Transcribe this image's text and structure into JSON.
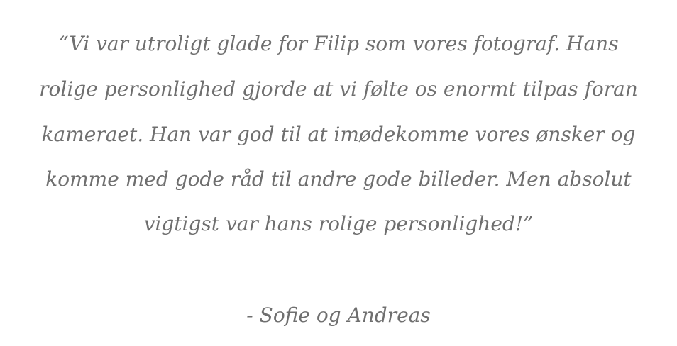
{
  "testimonial": {
    "quote_lines": [
      "“Vi var utroligt glade for Filip som vores fotograf. Hans",
      "rolige personlighed gjorde at vi følte os enormt tilpas foran",
      "kameraet. Han var god til at imødekomme vores ønsker og",
      "komme med gode råd til andre gode billeder. Men absolut",
      "vigtigst var hans rolige personlighed!”"
    ],
    "author": "- Sofie og Andreas"
  }
}
